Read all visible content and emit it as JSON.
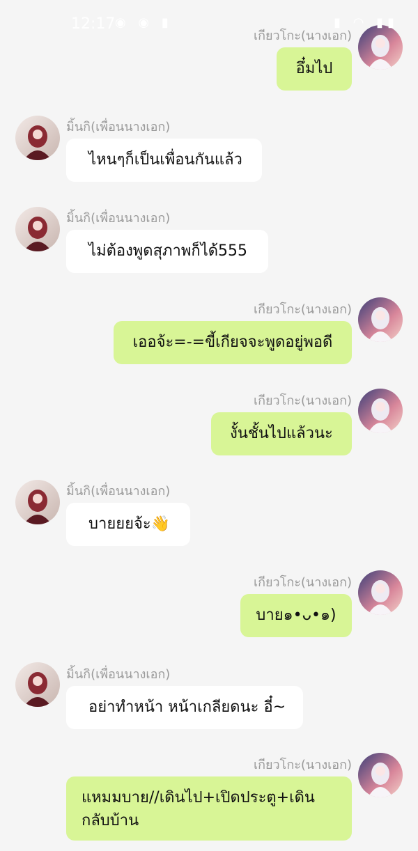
{
  "status_bar": {
    "time": "12:17",
    "left_icons": "◉ ◉ ▮",
    "right_icons": "▮ ◠ ▮▮"
  },
  "messages": [
    {
      "sender": "เกียวโกะ(นางเอก)",
      "side": "right",
      "text": "อึ๋มไป"
    },
    {
      "sender": "มิ้นกิ(เพื่อนนางเอก)",
      "side": "left",
      "text": "ไหนๆก็เป็นเพื่อนกันแล้ว"
    },
    {
      "sender": "มิ้นกิ(เพื่อนนางเอก)",
      "side": "left",
      "text": "ไม่ต้องพูดสุภาพก็ได้555"
    },
    {
      "sender": "เกียวโกะ(นางเอก)",
      "side": "right",
      "text": "เออจ้ะ=-=ขี้เกียจจะพูดอยู่พอดี"
    },
    {
      "sender": "เกียวโกะ(นางเอก)",
      "side": "right",
      "text": "งั้นชั้นไปแล้วนะ"
    },
    {
      "sender": "มิ้นกิ(เพื่อนนางเอก)",
      "side": "left",
      "text": "บายยยจ้ะ👋"
    },
    {
      "sender": "เกียวโกะ(นางเอก)",
      "side": "right",
      "text": "บาย๑•ᴗ•๑)"
    },
    {
      "sender": "มิ้นกิ(เพื่อนนางเอก)",
      "side": "left",
      "text": "อย่าทำหน้า หน้าเกลียดนะ อี๋~"
    },
    {
      "sender": "เกียวโกะ(นางเอก)",
      "side": "right",
      "text": "แหมมบาย//เดินไป+เปิดประตู+เดินกลับบ้าน"
    }
  ],
  "colors": {
    "background": "#f5f5f5",
    "incoming_bubble": "#ffffff",
    "outgoing_bubble": "#d8f596",
    "sender_name": "#9a9a9a"
  }
}
